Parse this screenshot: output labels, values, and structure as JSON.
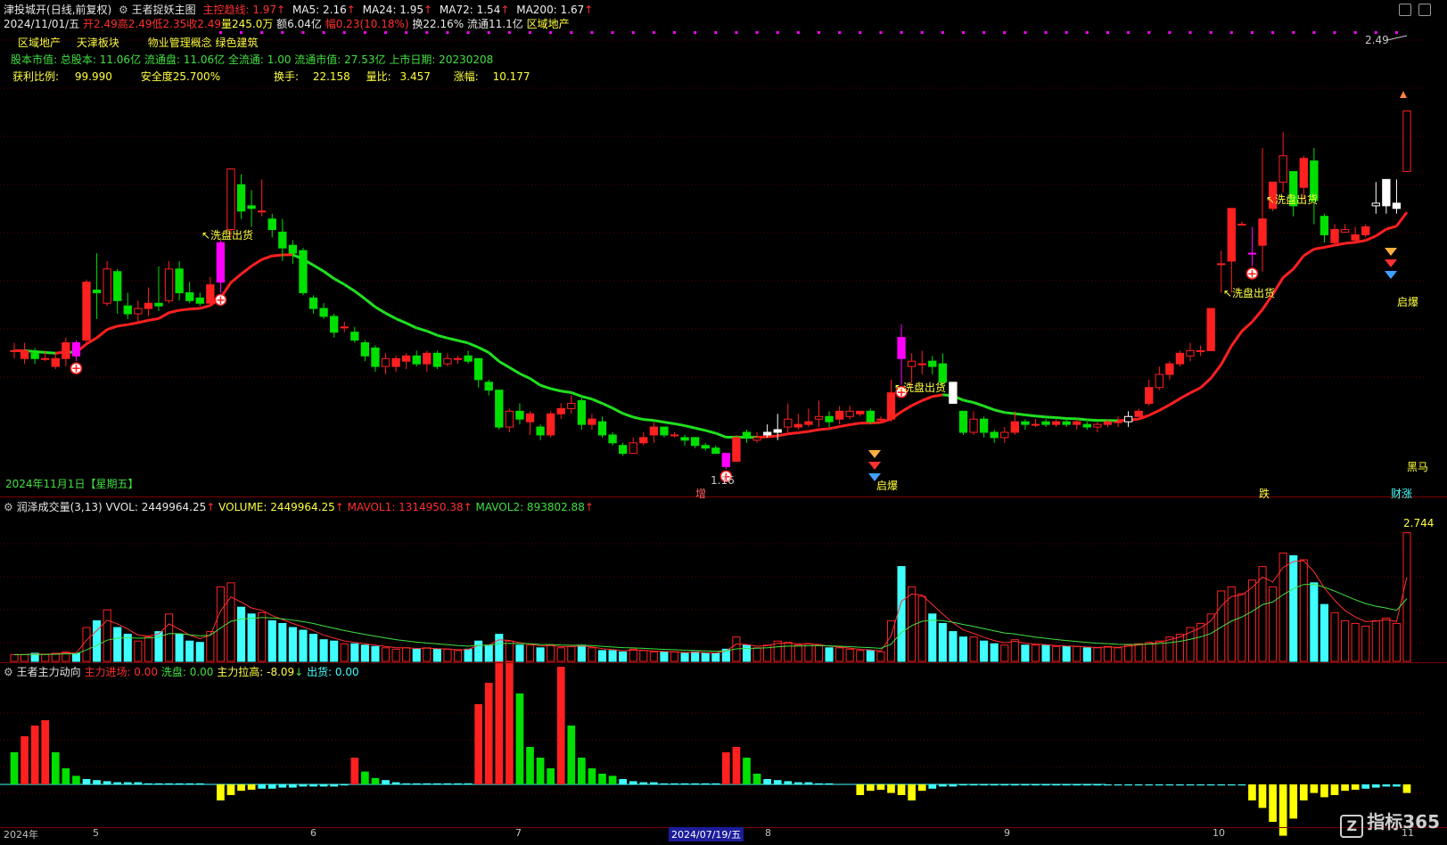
{
  "header": {
    "stock": "津投城开",
    "period": "(日线,前复权)",
    "indicator": "王者捉妖主图",
    "trend": "主控趋线: 1.97",
    "ma5": "MA5: 2.16",
    "ma24": "MA24: 1.95",
    "ma72": "MA72: 1.54",
    "ma200": "MA200: 1.67",
    "date": "2024/11/01/五",
    "open": "开2.49",
    "high": "高2.49",
    "low": "低2.35",
    "close": "收2.49",
    "vol": "量245.0万",
    "amount": "额6.04亿",
    "change": "幅0.23(10.18%)",
    "turnover": "换22.16%",
    "float": "流通11.1亿",
    "sector": "区域地产"
  },
  "info": {
    "tags": [
      "区域地产",
      "天津板块",
      "物业管理概念 绿色建筑"
    ],
    "line1": "股本市值: 总股本: 11.06亿 流通盘: 11.06亿 全流通: 1.00 流通市值: 27.53亿 上市日期: 20230208",
    "profit_label": "获利比例:",
    "profit_value": "99.990",
    "safety": "安全度25.700%",
    "turn_label": "换手:",
    "turn_value": "22.158",
    "ratio_label": "量比:",
    "ratio_value": "3.457",
    "rise_label": "涨幅:",
    "rise_value": "10.177"
  },
  "annotations": {
    "wash1": "↖洗盘出货",
    "wash2": "↖洗盘出货",
    "wash3": "↖洗盘出货",
    "wash4": "↖洗盘出货",
    "low_price": "1.16",
    "high_price": "2.49",
    "date_note": "2024年11月1日【星期五】",
    "heima": "黑马",
    "qibao1": "启爆",
    "qibao2": "启爆",
    "zeng": "增",
    "die": "跌",
    "caizhang": "财涨"
  },
  "volume_panel": {
    "title": "润泽成交量(3,13)",
    "vvol": "VVOL: 2449964.25",
    "volume": "VOLUME: 2449964.25",
    "mavol1": "MAVOL1: 1314950.38",
    "mavol2": "MAVOL2: 893802.88",
    "max_label": "2.744"
  },
  "force_panel": {
    "title": "王者主力动向",
    "enter": "主力进场: 0.00",
    "wash": "洗盘: 0.00",
    "pull": "主力拉高: -8.09",
    "out": "出货: 0.00"
  },
  "xaxis": {
    "labels": [
      "2024年",
      "5",
      "6",
      "7",
      "8",
      "9",
      "10",
      "11"
    ],
    "cursor": "2024/07/19/五"
  },
  "watermark": "指标365",
  "colors": {
    "up": "#ff2020",
    "down": "#00e000",
    "magenta": "#ff00ff",
    "cyan": "#40ffff",
    "yellow": "#ffff00",
    "trend_up": "#ff2020",
    "trend_down": "#20e020"
  },
  "chart_data": {
    "type": "candlestick",
    "ylim": [
      1.05,
      2.6
    ],
    "candles": [
      [
        1.58,
        1.58,
        1.61,
        1.55
      ],
      [
        1.55,
        1.58,
        1.61,
        1.53
      ],
      [
        1.57,
        1.55,
        1.59,
        1.53
      ],
      [
        1.55,
        1.55,
        1.58,
        1.54
      ],
      [
        1.52,
        1.55,
        1.57,
        1.51
      ],
      [
        1.55,
        1.61,
        1.63,
        1.52
      ],
      [
        1.61,
        1.56,
        1.62,
        1.54
      ],
      [
        1.62,
        1.84,
        1.85,
        1.6
      ],
      [
        1.81,
        1.8,
        1.95,
        1.7
      ],
      [
        1.76,
        1.89,
        1.92,
        1.75
      ],
      [
        1.88,
        1.77,
        1.89,
        1.72
      ],
      [
        1.75,
        1.72,
        1.8,
        1.7
      ],
      [
        1.72,
        1.74,
        1.77,
        1.69
      ],
      [
        1.74,
        1.76,
        1.82,
        1.71
      ],
      [
        1.76,
        1.75,
        1.9,
        1.73
      ],
      [
        1.77,
        1.89,
        1.92,
        1.76
      ],
      [
        1.89,
        1.8,
        1.92,
        1.77
      ],
      [
        1.8,
        1.77,
        1.84,
        1.76
      ],
      [
        1.78,
        1.76,
        1.8,
        1.75
      ],
      [
        1.76,
        1.83,
        1.86,
        1.75
      ],
      [
        1.84,
        1.99,
        2.0,
        1.8
      ],
      [
        2.04,
        2.27,
        2.27,
        2.01
      ],
      [
        2.21,
        2.11,
        2.25,
        2.08
      ],
      [
        2.13,
        2.12,
        2.19,
        2.05
      ],
      [
        2.11,
        2.11,
        2.23,
        2.09
      ],
      [
        2.08,
        2.04,
        2.1,
        2.01
      ],
      [
        2.03,
        1.97,
        2.08,
        1.92
      ],
      [
        1.98,
        1.95,
        2.0,
        1.91
      ],
      [
        1.96,
        1.8,
        1.97,
        1.79
      ],
      [
        1.78,
        1.74,
        1.79,
        1.72
      ],
      [
        1.74,
        1.71,
        1.76,
        1.7
      ],
      [
        1.71,
        1.65,
        1.72,
        1.63
      ],
      [
        1.67,
        1.67,
        1.69,
        1.65
      ],
      [
        1.65,
        1.62,
        1.67,
        1.61
      ],
      [
        1.61,
        1.56,
        1.62,
        1.54
      ],
      [
        1.59,
        1.52,
        1.6,
        1.5
      ],
      [
        1.52,
        1.55,
        1.57,
        1.49
      ],
      [
        1.52,
        1.55,
        1.56,
        1.5
      ],
      [
        1.54,
        1.56,
        1.57,
        1.51
      ],
      [
        1.56,
        1.53,
        1.58,
        1.52
      ],
      [
        1.53,
        1.57,
        1.58,
        1.5
      ],
      [
        1.57,
        1.52,
        1.58,
        1.51
      ],
      [
        1.53,
        1.55,
        1.57,
        1.52
      ],
      [
        1.55,
        1.55,
        1.56,
        1.53
      ],
      [
        1.56,
        1.54,
        1.58,
        1.53
      ],
      [
        1.55,
        1.47,
        1.55,
        1.44
      ],
      [
        1.46,
        1.43,
        1.47,
        1.41
      ],
      [
        1.43,
        1.29,
        1.43,
        1.28
      ],
      [
        1.29,
        1.35,
        1.36,
        1.27
      ],
      [
        1.35,
        1.32,
        1.38,
        1.3
      ],
      [
        1.31,
        1.34,
        1.35,
        1.26
      ],
      [
        1.29,
        1.26,
        1.3,
        1.24
      ],
      [
        1.26,
        1.34,
        1.35,
        1.25
      ],
      [
        1.34,
        1.36,
        1.38,
        1.32
      ],
      [
        1.36,
        1.38,
        1.41,
        1.34
      ],
      [
        1.39,
        1.3,
        1.4,
        1.28
      ],
      [
        1.3,
        1.32,
        1.34,
        1.28
      ],
      [
        1.31,
        1.26,
        1.33,
        1.25
      ],
      [
        1.26,
        1.23,
        1.27,
        1.22
      ],
      [
        1.22,
        1.19,
        1.23,
        1.18
      ],
      [
        1.19,
        1.23,
        1.25,
        1.19
      ],
      [
        1.23,
        1.25,
        1.27,
        1.22
      ],
      [
        1.26,
        1.29,
        1.31,
        1.23
      ],
      [
        1.29,
        1.26,
        1.29,
        1.25
      ],
      [
        1.26,
        1.26,
        1.27,
        1.25
      ],
      [
        1.25,
        1.24,
        1.26,
        1.22
      ],
      [
        1.25,
        1.22,
        1.25,
        1.21
      ],
      [
        1.22,
        1.21,
        1.23,
        1.2
      ],
      [
        1.21,
        1.19,
        1.22,
        1.19
      ],
      [
        1.19,
        1.14,
        1.19,
        1.13
      ],
      [
        1.16,
        1.25,
        1.26,
        1.16
      ],
      [
        1.27,
        1.25,
        1.28,
        1.23
      ],
      [
        1.24,
        1.25,
        1.27,
        1.23
      ],
      [
        1.26,
        1.27,
        1.3,
        1.25
      ],
      [
        1.27,
        1.28,
        1.34,
        1.24
      ],
      [
        1.29,
        1.32,
        1.38,
        1.27
      ],
      [
        1.29,
        1.3,
        1.34,
        1.28
      ],
      [
        1.3,
        1.31,
        1.36,
        1.29
      ],
      [
        1.32,
        1.33,
        1.39,
        1.29
      ],
      [
        1.33,
        1.31,
        1.35,
        1.29
      ],
      [
        1.32,
        1.35,
        1.37,
        1.3
      ],
      [
        1.33,
        1.35,
        1.37,
        1.32
      ],
      [
        1.34,
        1.35,
        1.35,
        1.33
      ],
      [
        1.35,
        1.31,
        1.36,
        1.3
      ],
      [
        1.32,
        1.32,
        1.33,
        1.31
      ],
      [
        1.32,
        1.42,
        1.47,
        1.31
      ],
      [
        1.63,
        1.55,
        1.68,
        1.45
      ],
      [
        1.52,
        1.54,
        1.57,
        1.44
      ],
      [
        1.53,
        1.53,
        1.58,
        1.49
      ],
      [
        1.54,
        1.52,
        1.56,
        1.49
      ],
      [
        1.53,
        1.46,
        1.57,
        1.44
      ],
      [
        1.46,
        1.38,
        1.46,
        1.38
      ],
      [
        1.35,
        1.27,
        1.35,
        1.26
      ],
      [
        1.27,
        1.32,
        1.35,
        1.26
      ],
      [
        1.32,
        1.27,
        1.33,
        1.25
      ],
      [
        1.27,
        1.25,
        1.28,
        1.23
      ],
      [
        1.25,
        1.27,
        1.29,
        1.23
      ],
      [
        1.27,
        1.31,
        1.35,
        1.26
      ],
      [
        1.31,
        1.3,
        1.32,
        1.28
      ],
      [
        1.3,
        1.3,
        1.32,
        1.29
      ],
      [
        1.31,
        1.3,
        1.32,
        1.29
      ],
      [
        1.3,
        1.31,
        1.32,
        1.29
      ],
      [
        1.31,
        1.3,
        1.32,
        1.29
      ],
      [
        1.3,
        1.31,
        1.32,
        1.28
      ],
      [
        1.3,
        1.29,
        1.31,
        1.28
      ],
      [
        1.29,
        1.3,
        1.31,
        1.27
      ],
      [
        1.3,
        1.31,
        1.32,
        1.29
      ],
      [
        1.31,
        1.31,
        1.33,
        1.29
      ],
      [
        1.31,
        1.33,
        1.35,
        1.29
      ],
      [
        1.33,
        1.35,
        1.36,
        1.33
      ],
      [
        1.38,
        1.44,
        1.47,
        1.37
      ],
      [
        1.44,
        1.49,
        1.52,
        1.43
      ],
      [
        1.49,
        1.53,
        1.54,
        1.47
      ],
      [
        1.53,
        1.57,
        1.58,
        1.52
      ],
      [
        1.56,
        1.58,
        1.61,
        1.54
      ],
      [
        1.58,
        1.58,
        1.6,
        1.56
      ],
      [
        1.58,
        1.74,
        1.74,
        1.58
      ],
      [
        1.91,
        1.91,
        1.96,
        1.8
      ],
      [
        1.92,
        2.12,
        2.12,
        1.8
      ],
      [
        2.06,
        2.06,
        2.07,
        2.06
      ],
      [
        1.95,
        1.95,
        2.05,
        1.9
      ],
      [
        1.98,
        2.08,
        2.35,
        1.88
      ],
      [
        2.12,
        2.22,
        2.22,
        2.11
      ],
      [
        2.22,
        2.32,
        2.41,
        2.18
      ],
      [
        2.26,
        2.13,
        2.26,
        2.09
      ],
      [
        2.2,
        2.31,
        2.32,
        2.15
      ],
      [
        2.3,
        2.15,
        2.35,
        2.06
      ],
      [
        2.09,
        2.02,
        2.1,
        1.99
      ],
      [
        1.99,
        2.04,
        2.06,
        1.98
      ],
      [
        2.03,
        2.04,
        2.06,
        2.03
      ],
      [
        2.0,
        2.02,
        2.05,
        1.99
      ],
      [
        2.02,
        2.05,
        2.06,
        2.01
      ],
      [
        2.13,
        2.14,
        2.22,
        2.1
      ],
      [
        2.13,
        2.23,
        2.23,
        2.1
      ],
      [
        2.12,
        2.14,
        2.23,
        2.1
      ],
      [
        2.26,
        2.49,
        2.49,
        2.35
      ]
    ],
    "signals": {
      "magenta_bars": [
        6,
        20,
        69,
        86,
        120
      ],
      "magenta_plus": [
        6,
        20,
        69,
        86,
        120
      ],
      "white_candles": [
        73,
        74,
        91,
        108,
        132,
        133,
        134
      ]
    },
    "volume": [
      0.05,
      0.05,
      0.06,
      0.05,
      0.06,
      0.07,
      0.06,
      0.25,
      0.3,
      0.38,
      0.25,
      0.2,
      0.15,
      0.18,
      0.22,
      0.35,
      0.2,
      0.15,
      0.14,
      0.22,
      0.55,
      0.58,
      0.4,
      0.35,
      0.36,
      0.3,
      0.28,
      0.25,
      0.23,
      0.2,
      0.16,
      0.15,
      0.13,
      0.13,
      0.12,
      0.11,
      0.1,
      0.09,
      0.1,
      0.09,
      0.1,
      0.09,
      0.09,
      0.08,
      0.09,
      0.15,
      0.12,
      0.2,
      0.15,
      0.12,
      0.12,
      0.1,
      0.12,
      0.1,
      0.11,
      0.12,
      0.1,
      0.08,
      0.08,
      0.07,
      0.09,
      0.08,
      0.07,
      0.07,
      0.07,
      0.06,
      0.07,
      0.06,
      0.06,
      0.09,
      0.18,
      0.12,
      0.1,
      0.12,
      0.15,
      0.14,
      0.12,
      0.13,
      0.12,
      0.1,
      0.1,
      0.09,
      0.08,
      0.08,
      0.07,
      0.3,
      0.7,
      0.55,
      0.48,
      0.35,
      0.28,
      0.22,
      0.18,
      0.18,
      0.15,
      0.13,
      0.12,
      0.16,
      0.12,
      0.12,
      0.12,
      0.11,
      0.11,
      0.11,
      0.1,
      0.1,
      0.11,
      0.1,
      0.12,
      0.13,
      0.14,
      0.15,
      0.18,
      0.2,
      0.25,
      0.28,
      0.35,
      0.52,
      0.55,
      0.5,
      0.6,
      0.7,
      0.55,
      0.8,
      0.78,
      0.75,
      0.58,
      0.42,
      0.36,
      0.3,
      0.28,
      0.26,
      0.3,
      0.32,
      0.28,
      0.95
    ],
    "force": [
      0.3,
      0.45,
      0.55,
      0.6,
      0.3,
      0.15,
      0.08,
      0.05,
      0.04,
      0.03,
      0.02,
      0.02,
      0.02,
      0.01,
      0.01,
      0.01,
      0.01,
      0.01,
      0.01,
      0.0,
      -0.15,
      -0.1,
      -0.06,
      -0.05,
      -0.04,
      -0.04,
      -0.03,
      -0.03,
      -0.02,
      -0.02,
      -0.02,
      -0.02,
      -0.01,
      0.25,
      0.12,
      0.06,
      0.04,
      0.02,
      0.01,
      0.01,
      0.01,
      0.01,
      0.01,
      0.01,
      0.01,
      0.75,
      0.95,
      1.15,
      1.15,
      0.85,
      0.35,
      0.25,
      0.15,
      1.1,
      0.55,
      0.25,
      0.15,
      0.1,
      0.08,
      0.05,
      0.03,
      0.02,
      0.02,
      0.01,
      0.01,
      0.01,
      0.01,
      0.01,
      0.01,
      0.3,
      0.35,
      0.25,
      0.1,
      0.05,
      0.04,
      0.03,
      0.02,
      0.02,
      0.01,
      0.01,
      0.0,
      0.0,
      -0.1,
      -0.06,
      -0.05,
      -0.08,
      -0.1,
      -0.15,
      -0.06,
      -0.04,
      -0.02,
      -0.02,
      -0.01,
      -0.01,
      -0.01,
      -0.01,
      -0.01,
      -0.01,
      -0.01,
      -0.01,
      -0.01,
      -0.01,
      -0.01,
      -0.01,
      -0.01,
      -0.01,
      -0.01,
      -0.01,
      -0.01,
      -0.01,
      -0.01,
      -0.01,
      -0.01,
      -0.01,
      -0.01,
      -0.01,
      -0.01,
      -0.01,
      -0.01,
      -0.01,
      -0.15,
      -0.22,
      -0.35,
      -0.48,
      -0.32,
      -0.15,
      -0.08,
      -0.12,
      -0.1,
      -0.06,
      -0.05,
      -0.04,
      -0.03,
      -0.02,
      -0.02,
      -0.08
    ]
  }
}
